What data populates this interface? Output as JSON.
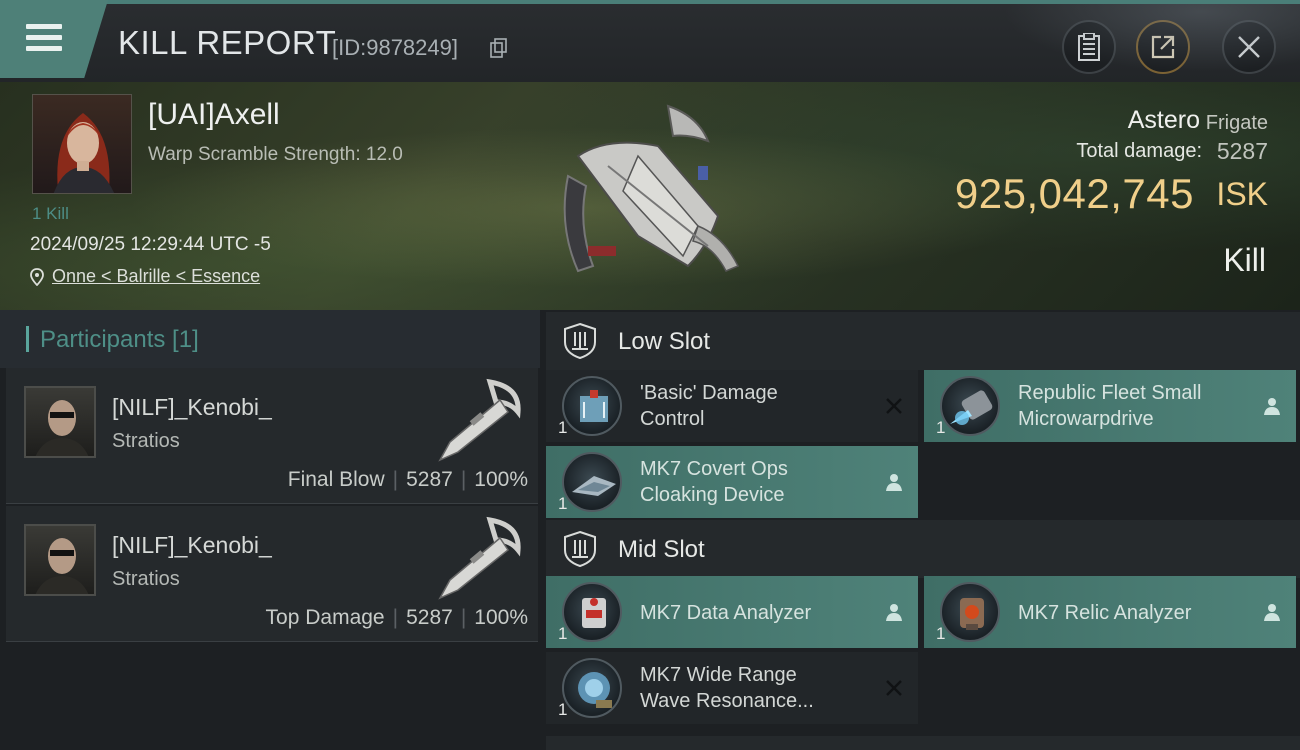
{
  "header": {
    "title": "KILL REPORT",
    "report_id": "[ID:9878249]"
  },
  "victim": {
    "name": "[UAI]Axell",
    "scramble": "Warp Scramble Strength: 12.0",
    "kill_count": "1 Kill",
    "date": "2024/09/25 12:29:44 UTC -5",
    "location": "Onne < Balrille < Essence",
    "ship_name": "Astero",
    "ship_class": "Frigate",
    "total_damage_label": "Total damage:",
    "total_damage": "5287",
    "isk_value": "925,042,745",
    "isk_unit": "ISK",
    "kill_type": "Kill"
  },
  "participants": {
    "title": "Participants [1]",
    "rows": [
      {
        "name": "[NILF]_Kenobi_",
        "ship": "Stratios",
        "role": "Final Blow",
        "damage": "5287",
        "percent": "100%"
      },
      {
        "name": "[NILF]_Kenobi_",
        "ship": "Stratios",
        "role": "Top Damage",
        "damage": "5287",
        "percent": "100%"
      }
    ]
  },
  "low_slot": {
    "label": "Low Slot",
    "modules": [
      {
        "line1": "'Basic' Damage",
        "line2": "Control",
        "qty": "1",
        "status": "destroyed"
      },
      {
        "line1": "Republic Fleet Small",
        "line2": "Microwarpdrive",
        "qty": "1",
        "status": "dropped"
      },
      {
        "line1": "MK7 Covert Ops",
        "line2": "Cloaking Device",
        "qty": "1",
        "status": "dropped"
      }
    ]
  },
  "mid_slot": {
    "label": "Mid Slot",
    "modules": [
      {
        "line1": "MK7 Data Analyzer",
        "qty": "1",
        "status": "dropped"
      },
      {
        "line1": "MK7 Relic Analyzer",
        "qty": "1",
        "status": "dropped"
      },
      {
        "line1": "MK7 Wide Range",
        "line2": "Wave Resonance...",
        "qty": "1",
        "status": "destroyed"
      }
    ]
  },
  "colors": {
    "accent_teal": "#4e8078",
    "isk_gold": "#f0cf8a",
    "dropped_bg": "#4f8279",
    "destroyed_bg": "#222629"
  }
}
